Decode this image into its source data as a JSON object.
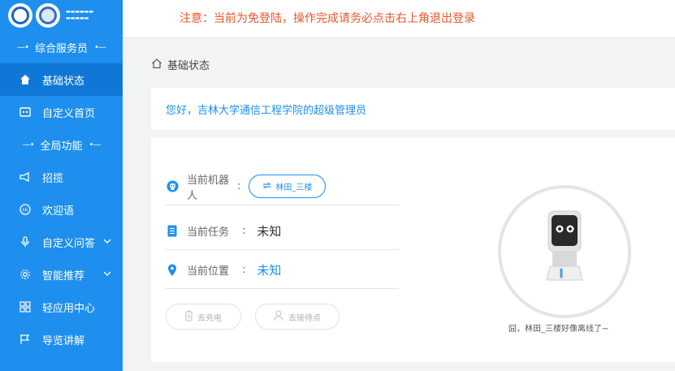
{
  "sidebar": {
    "sections": [
      {
        "title": "综合服务员"
      },
      {
        "title": "全局功能"
      }
    ],
    "items": [
      {
        "label": "基础状态",
        "icon": "home-icon"
      },
      {
        "label": "自定义首页",
        "icon": "screen-icon"
      },
      {
        "label": "招揽",
        "icon": "megaphone-icon"
      },
      {
        "label": "欢迎语",
        "icon": "hi-icon"
      },
      {
        "label": "自定义问答",
        "icon": "microphone-icon"
      },
      {
        "label": "智能推荐",
        "icon": "gear-icon"
      },
      {
        "label": "轻应用中心",
        "icon": "grid-icon"
      },
      {
        "label": "导览讲解",
        "icon": "flag-icon"
      }
    ]
  },
  "topbar": {
    "notice": "注意：当前为免登陆，操作完成请务必点击右上角退出登录"
  },
  "breadcrumb": {
    "label": "基础状态"
  },
  "welcome": {
    "text": "您好，吉林大学通信工程学院的超级管理员"
  },
  "status": {
    "robot_label": "当前机器人",
    "robot_colon": ":",
    "robot_name": "林田_三楼",
    "task_label": "当前任务",
    "task_colon": ":",
    "task_value": "未知",
    "location_label": "当前位置",
    "location_colon": ":",
    "location_value": "未知",
    "charge_button": "去充电",
    "standby_button": "去接待点",
    "offline_message": "囧，林田_三楼好像离线了~"
  },
  "colors": {
    "sidebar": "#1e8fee",
    "sidebar_active": "#0f78d6",
    "notice": "#e8552b",
    "accent": "#1e8fee"
  }
}
